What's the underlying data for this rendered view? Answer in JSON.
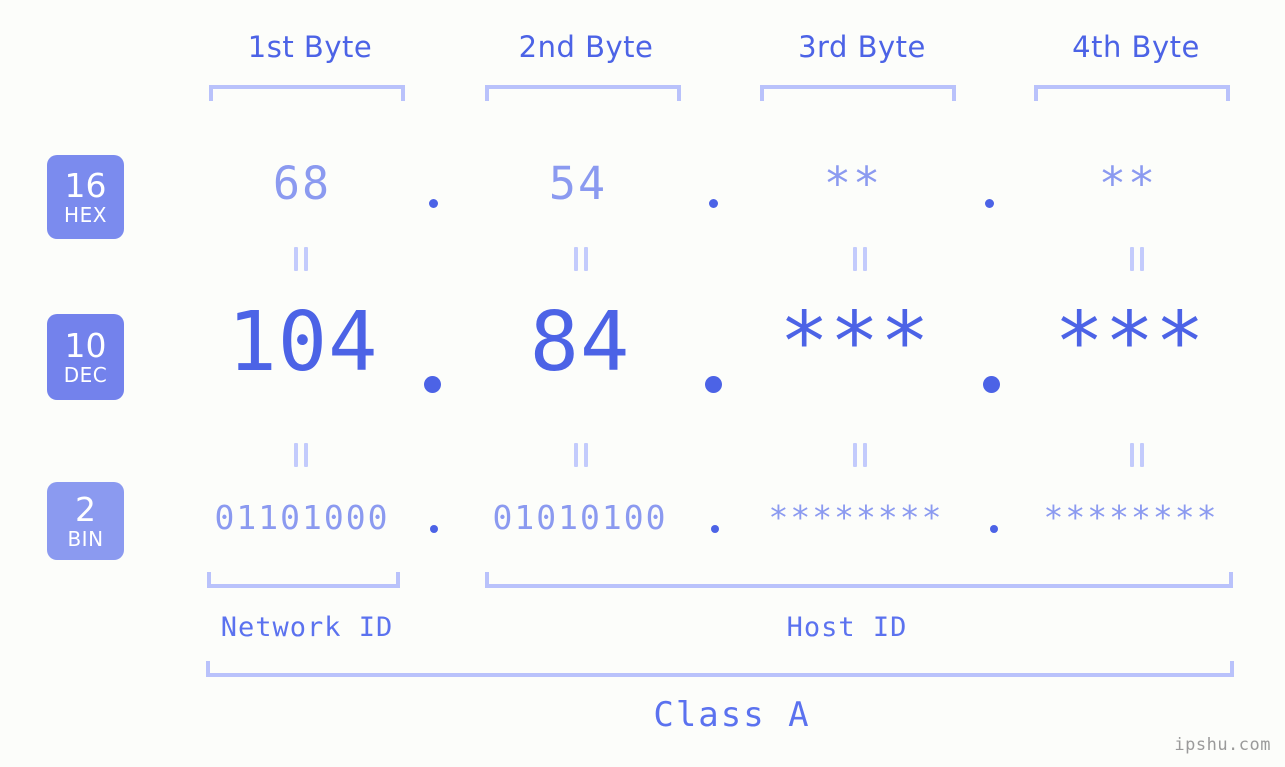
{
  "page": {
    "background_color": "#fcfdfa",
    "accent_color": "#4c63e6",
    "accent_light_color": "#8b9af0",
    "bracket_color": "#b9c2fb",
    "watermark": "ipshu.com"
  },
  "headers": {
    "byte1": "1st Byte",
    "byte2": "2nd Byte",
    "byte3": "3rd Byte",
    "byte4": "4th Byte"
  },
  "bases": [
    {
      "number": "16",
      "abbr": "HEX"
    },
    {
      "number": "10",
      "abbr": "DEC"
    },
    {
      "number": "2",
      "abbr": "BIN"
    }
  ],
  "rows": {
    "hex": {
      "label_number": "16",
      "label_abbr": "HEX",
      "values": [
        "68",
        "54",
        "**",
        "**"
      ],
      "separator": "."
    },
    "dec": {
      "label_number": "10",
      "label_abbr": "DEC",
      "values": [
        "104",
        "84",
        "***",
        "***"
      ],
      "separator": "."
    },
    "bin": {
      "label_number": "2",
      "label_abbr": "BIN",
      "values": [
        "01101000",
        "01010100",
        "********",
        "********"
      ],
      "separator": "."
    }
  },
  "equivalence_symbol": "=",
  "segments": {
    "network_id": "Network ID",
    "host_id": "Host ID",
    "class": "Class A"
  }
}
